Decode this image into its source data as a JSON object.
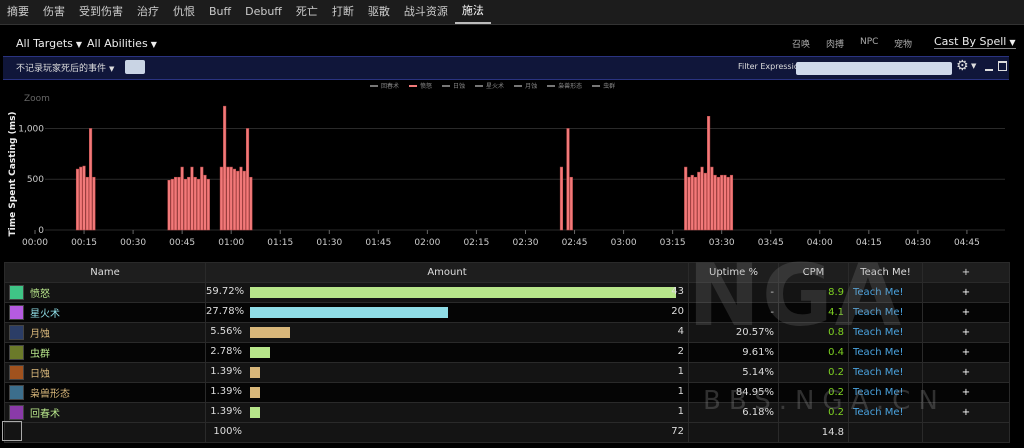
{
  "tabs": [
    "摘要",
    "伤害",
    "受到伤害",
    "治疗",
    "仇恨",
    "Buff",
    "Debuff",
    "死亡",
    "打断",
    "驱散",
    "战斗资源",
    "施法"
  ],
  "active_tab": "施法",
  "toolbar": {
    "targets": "All Targets",
    "abilities": "All Abilities",
    "right_links": [
      "召唤",
      "肉搏",
      "NPC",
      "宠物"
    ],
    "cast_by": "Cast By Spell"
  },
  "filter_bar": {
    "event_filter": "不记录玩家死后的事件",
    "expression_label": "Filter Expression:",
    "expression_value": ""
  },
  "chart_data": {
    "type": "bar",
    "zoom_label": "Zoom",
    "ylabel": "Time Spent Casting (ms)",
    "ylim": [
      0,
      1300
    ],
    "yticks": [
      0,
      500,
      1000
    ],
    "ytick_labels": [
      "0",
      "500",
      "1,000"
    ],
    "xtick_labels": [
      "00:00",
      "00:15",
      "00:30",
      "00:45",
      "01:00",
      "01:15",
      "01:30",
      "01:45",
      "02:00",
      "02:15",
      "02:30",
      "02:45",
      "03:00",
      "03:15",
      "03:30",
      "03:45",
      "04:00",
      "04:15",
      "04:30",
      "04:45"
    ],
    "xrange_seconds": [
      0,
      289
    ],
    "legend": [
      "回春术",
      "愤怒",
      "日蚀",
      "星火术",
      "月蚀",
      "枭兽形态",
      "虫群"
    ],
    "active_series": "愤怒",
    "bar_color": "#f27a7a",
    "points": [
      [
        13,
        600
      ],
      [
        14,
        620
      ],
      [
        15,
        630
      ],
      [
        16,
        520
      ],
      [
        17,
        1000
      ],
      [
        18,
        520
      ],
      [
        41,
        490
      ],
      [
        42,
        500
      ],
      [
        43,
        520
      ],
      [
        44,
        520
      ],
      [
        45,
        620
      ],
      [
        46,
        500
      ],
      [
        47,
        520
      ],
      [
        48,
        620
      ],
      [
        49,
        520
      ],
      [
        50,
        500
      ],
      [
        51,
        620
      ],
      [
        52,
        540
      ],
      [
        53,
        500
      ],
      [
        57,
        620
      ],
      [
        58,
        1220
      ],
      [
        59,
        620
      ],
      [
        60,
        620
      ],
      [
        61,
        600
      ],
      [
        62,
        580
      ],
      [
        63,
        620
      ],
      [
        64,
        580
      ],
      [
        65,
        1000
      ],
      [
        66,
        520
      ],
      [
        161,
        620
      ],
      [
        163,
        1000
      ],
      [
        164,
        520
      ],
      [
        199,
        620
      ],
      [
        200,
        520
      ],
      [
        201,
        540
      ],
      [
        202,
        520
      ],
      [
        203,
        570
      ],
      [
        204,
        620
      ],
      [
        205,
        560
      ],
      [
        206,
        1120
      ],
      [
        207,
        620
      ],
      [
        208,
        540
      ],
      [
        209,
        520
      ],
      [
        210,
        540
      ],
      [
        211,
        540
      ],
      [
        212,
        520
      ],
      [
        213,
        540
      ]
    ]
  },
  "table": {
    "headers": [
      "Name",
      "Amount",
      "Uptime %",
      "CPM",
      "Teach Me!",
      "+"
    ],
    "rows": [
      {
        "name": "愤怒",
        "pct": "59.72%",
        "frac": 0.5972,
        "count": "43",
        "uptime": "-",
        "cpm": "8.9",
        "color": "#b7e58a",
        "icon": "wrath-icon",
        "icon_color": "#3fc486"
      },
      {
        "name": "星火术",
        "pct": "27.78%",
        "frac": 0.2778,
        "count": "20",
        "uptime": "-",
        "cpm": "4.1",
        "color": "#8fdde6",
        "icon": "starfire-icon",
        "icon_color": "#b55be0"
      },
      {
        "name": "月蚀",
        "pct": "5.56%",
        "frac": 0.0556,
        "count": "4",
        "uptime": "20.57%",
        "cpm": "0.8",
        "color": "#d8b77a",
        "icon": "lunar-eclipse-icon",
        "icon_color": "#2b3d66"
      },
      {
        "name": "虫群",
        "pct": "2.78%",
        "frac": 0.0278,
        "count": "2",
        "uptime": "9.61%",
        "cpm": "0.4",
        "color": "#b7e58a",
        "icon": "insect-swarm-icon",
        "icon_color": "#6b7a2a"
      },
      {
        "name": "日蚀",
        "pct": "1.39%",
        "frac": 0.0139,
        "count": "1",
        "uptime": "5.14%",
        "cpm": "0.2",
        "color": "#d8b77a",
        "icon": "solar-eclipse-icon",
        "icon_color": "#a0521e"
      },
      {
        "name": "枭兽形态",
        "pct": "1.39%",
        "frac": 0.0139,
        "count": "1",
        "uptime": "84.95%",
        "cpm": "0.2",
        "color": "#d8b77a",
        "icon": "moonkin-form-icon",
        "icon_color": "#3c6e8c"
      },
      {
        "name": "回春术",
        "pct": "1.39%",
        "frac": 0.0139,
        "count": "1",
        "uptime": "6.18%",
        "cpm": "0.2",
        "color": "#b7e58a",
        "icon": "rejuvenation-icon",
        "icon_color": "#8a3aa8"
      }
    ],
    "totals": {
      "pct": "100%",
      "count": "72",
      "cpm": "14.8"
    },
    "teach_label": "Teach Me!",
    "plus_label": "+"
  },
  "watermark": {
    "logo": "NGA",
    "site": "BBS.NGA.CN"
  }
}
